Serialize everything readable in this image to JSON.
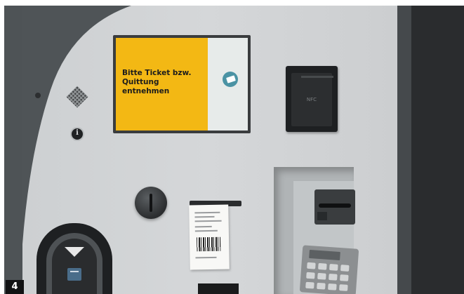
{
  "display": {
    "message": "Bitte Ticket bzw.\nQuittung\nentnehmen",
    "accent_color": "#f3b814",
    "icon": "ticket-take-icon"
  },
  "nfc_reader": {
    "label": "NFC",
    "icon": "contactless-icon"
  },
  "info_button": {
    "label": "i",
    "icon": "info-icon"
  },
  "figure": {
    "label": "4"
  },
  "icons": [
    "speaker-icon",
    "microphone-icon",
    "coin-slot-icon",
    "card-insert-arrow-icon",
    "card-icon",
    "pin-pad-icon",
    "card-reader-icon"
  ]
}
